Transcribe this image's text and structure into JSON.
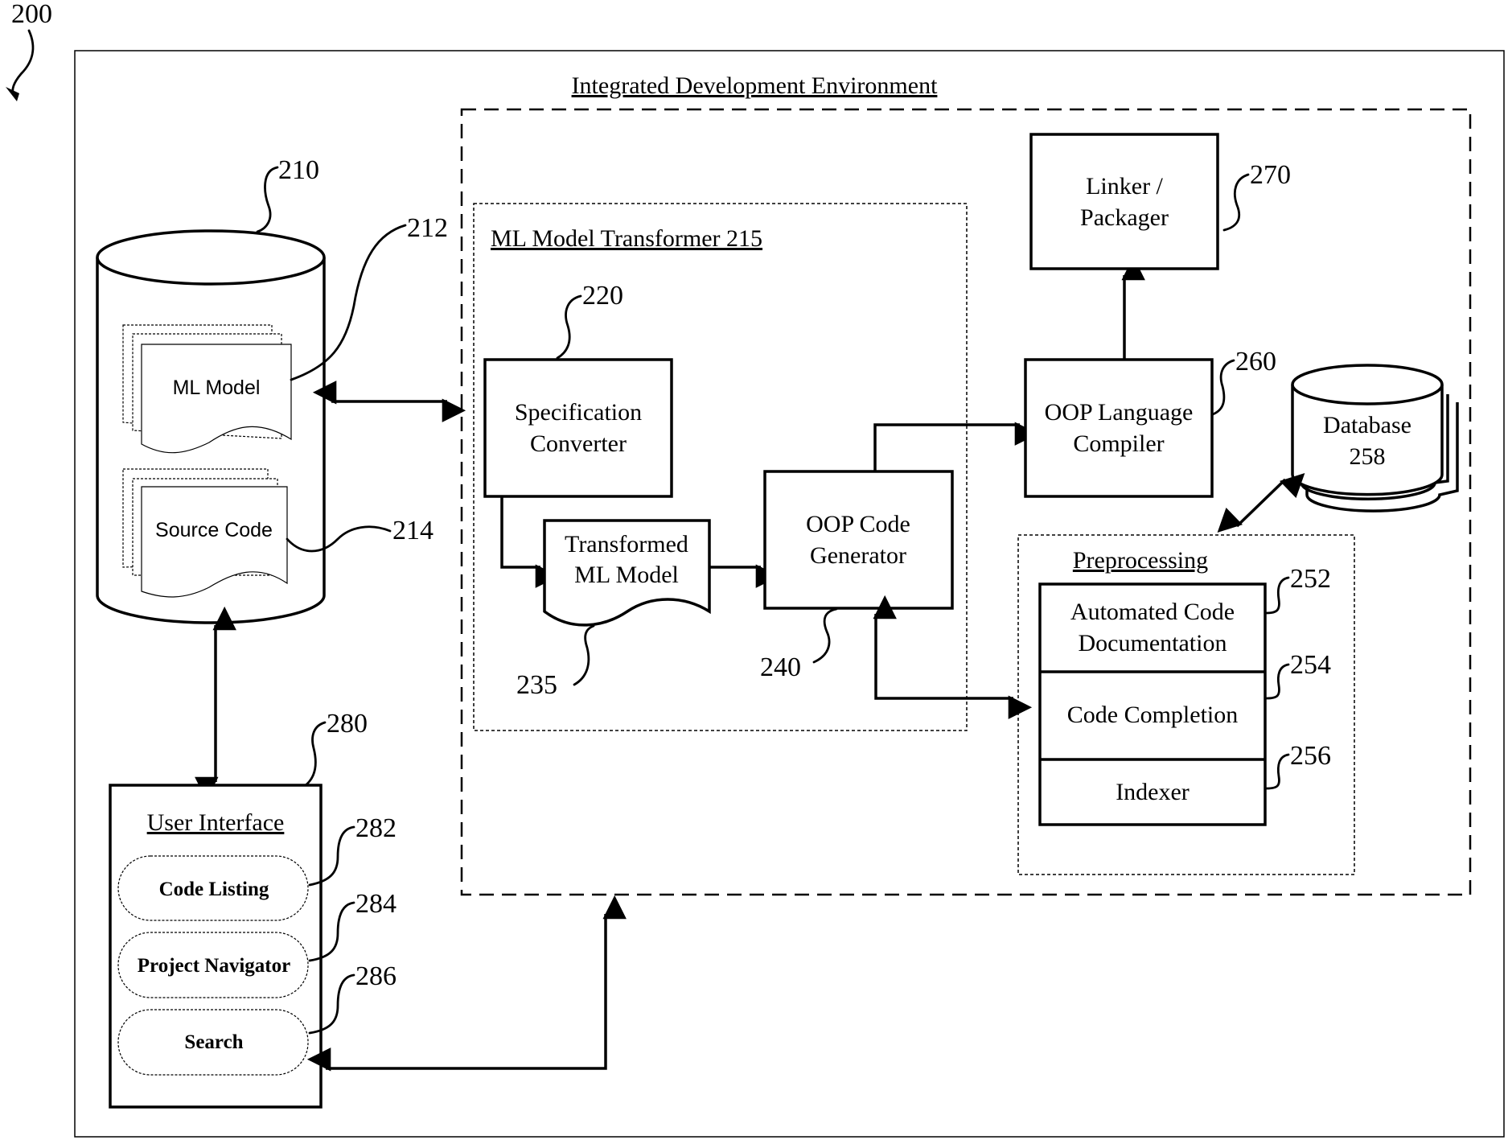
{
  "figure": {
    "ref": "200",
    "title": "Integrated Development Environment"
  },
  "storage": {
    "ref": "210",
    "ml_model": {
      "label": "ML Model",
      "ref": "212"
    },
    "source_code": {
      "label": "Source Code",
      "ref": "214"
    }
  },
  "transformer": {
    "title": "ML Model Transformer 215",
    "spec_converter": {
      "line1": "Specification",
      "line2": "Converter",
      "ref": "220"
    },
    "transformed_model": {
      "line1": "Transformed",
      "line2": "ML Model",
      "ref": "235"
    },
    "code_generator": {
      "line1": "OOP Code",
      "line2": "Generator",
      "ref": "240"
    }
  },
  "compiler": {
    "line1": "OOP Language",
    "line2": "Compiler",
    "ref": "260"
  },
  "linker": {
    "line1": "Linker /",
    "line2": "Packager",
    "ref": "270"
  },
  "database": {
    "line1": "Database",
    "line2": "258"
  },
  "preprocessing": {
    "title": "Preprocessing",
    "items": [
      {
        "line1": "Automated Code",
        "line2": "Documentation",
        "ref": "252"
      },
      {
        "line1": "Code Completion",
        "ref": "254"
      },
      {
        "line1": "Indexer",
        "ref": "256"
      }
    ]
  },
  "user_interface": {
    "title": "User Interface",
    "ref": "280",
    "items": [
      {
        "label": "Code Listing",
        "ref": "282"
      },
      {
        "label": "Project Navigator",
        "ref": "284"
      },
      {
        "label": "Search",
        "ref": "286"
      }
    ]
  }
}
